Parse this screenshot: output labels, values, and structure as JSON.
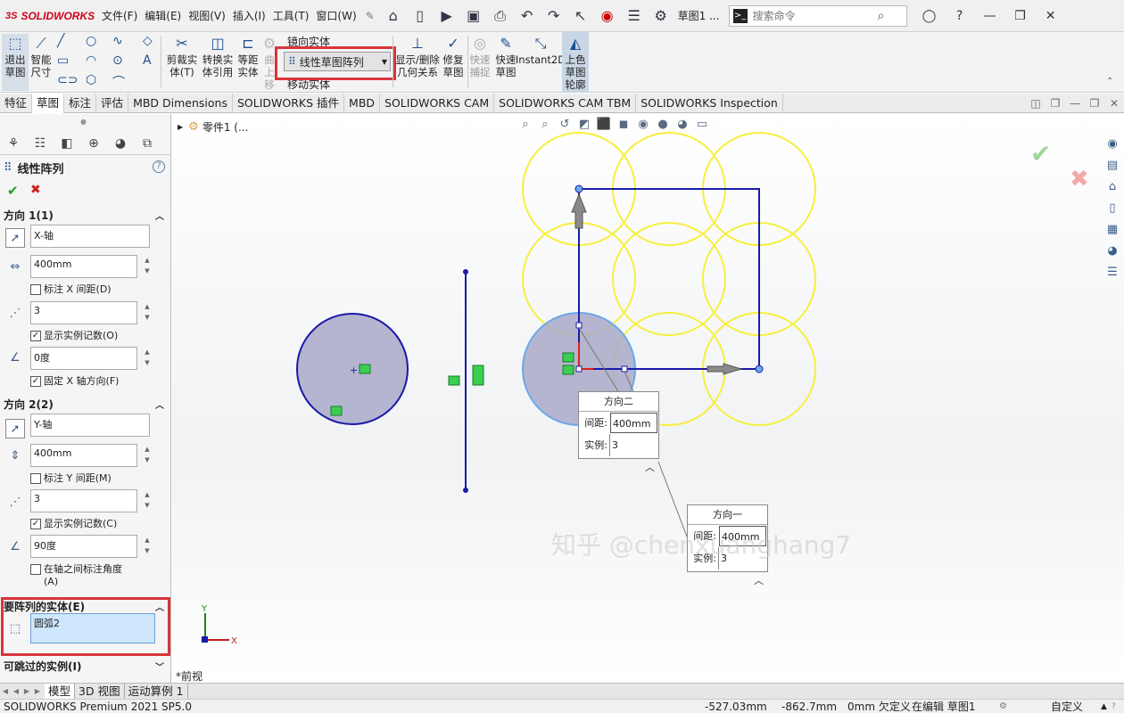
{
  "app": {
    "logo_text": "SOLIDWORKS",
    "logo_prefix": "3S",
    "menus": [
      "文件(F)",
      "编辑(E)",
      "视图(V)",
      "插入(I)",
      "工具(T)",
      "窗口(W)"
    ],
    "doc_title": "草图1 ...",
    "search_placeholder": "搜索命令"
  },
  "ribbon": {
    "exit_sketch": "退出草图",
    "smart_dim": "智能尺寸",
    "trim": "剪裁实体(T)",
    "convert": "转换实体引用",
    "offset": "等距实体",
    "surface_offset_a": "曲",
    "surface_offset_b": "上",
    "surface_offset_c": "移",
    "mirror": "镜向实体",
    "linear_pattern": "线性草图阵列",
    "move": "移动实体",
    "display_relations": "显示/删除几何关系",
    "repair": "修复草图",
    "quick_snap": "快速捕捉",
    "rapid_sketch": "快速草图",
    "instant2d": "Instant2D",
    "shaded_contours": "上色草图轮廓"
  },
  "command_tabs": [
    "特征",
    "草图",
    "标注",
    "评估",
    "MBD Dimensions",
    "SOLIDWORKS 插件",
    "MBD",
    "SOLIDWORKS CAM",
    "SOLIDWORKS CAM TBM",
    "SOLIDWORKS Inspection"
  ],
  "active_tab": "草图",
  "property_manager": {
    "title": "线性阵列",
    "help": "?",
    "ok": "✔",
    "cancel": "✖",
    "direction1": {
      "header": "方向 1(1)",
      "axis": "X-轴",
      "spacing": "400mm",
      "dimension_label": "标注 X 间距(D)",
      "dimension_checked": false,
      "instances": "3",
      "show_count_label": "显示实例记数(O)",
      "show_count_checked": true,
      "angle": "0度",
      "fix_label": "固定 X 轴方向(F)",
      "fix_checked": true
    },
    "direction2": {
      "header": "方向 2(2)",
      "axis": "Y-轴",
      "spacing": "400mm",
      "dimension_label": "标注 Y 间距(M)",
      "dimension_checked": false,
      "instances": "3",
      "show_count_label": "显示实例记数(C)",
      "show_count_checked": true,
      "angle": "90度",
      "between_label_1": "在轴之间标注角度",
      "between_label_2": "(A)",
      "between_checked": false
    },
    "entities": {
      "header": "要阵列的实体(E)",
      "value": "圆弧2"
    },
    "skip": {
      "header": "可跳过的实例(I)"
    }
  },
  "canvas": {
    "tree_item": "零件1 (...",
    "view_label": "*前视",
    "callout_dir2": {
      "title": "方向二",
      "spacing_label": "间距:",
      "spacing": "400mm",
      "instances_label": "实例:",
      "instances": "3"
    },
    "callout_dir1": {
      "title": "方向一",
      "spacing_label": "间距:",
      "spacing": "400mm",
      "instances_label": "实例:",
      "instances": "3"
    },
    "triad_y": "Y",
    "triad_x": "X",
    "watermark": "知乎 @chenxuanghang7",
    "colors": {
      "pattern_yellow": "#f5f03c",
      "sketch_blue": "#1a1aa8",
      "fill": "#a9a9c9"
    }
  },
  "bottom_tabs": [
    "模型",
    "3D 视图",
    "运动算例 1"
  ],
  "active_bottom_tab": "模型",
  "status": {
    "product": "SOLIDWORKS Premium 2021 SP5.0",
    "x": "-527.03mm",
    "y": "-862.7mm",
    "z": "0mm 欠定义",
    "editing": "在编辑 草图1",
    "units": "自定义"
  }
}
